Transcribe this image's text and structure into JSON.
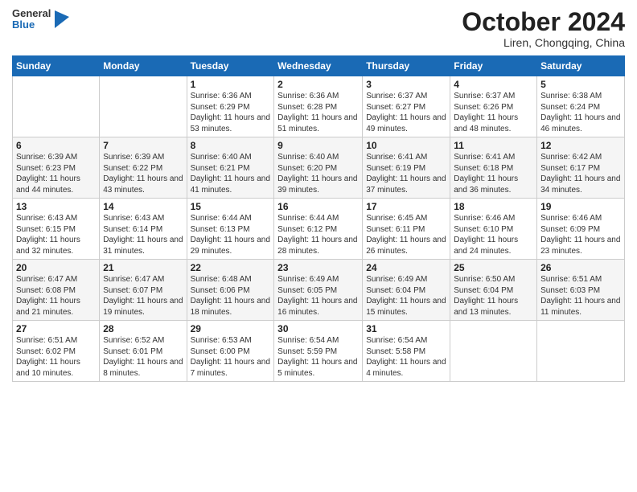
{
  "logo": {
    "line1": "General",
    "line2": "Blue"
  },
  "title": "October 2024",
  "location": "Liren, Chongqing, China",
  "days_of_week": [
    "Sunday",
    "Monday",
    "Tuesday",
    "Wednesday",
    "Thursday",
    "Friday",
    "Saturday"
  ],
  "weeks": [
    [
      {
        "day": "",
        "info": ""
      },
      {
        "day": "",
        "info": ""
      },
      {
        "day": "1",
        "info": "Sunrise: 6:36 AM\nSunset: 6:29 PM\nDaylight: 11 hours and 53 minutes."
      },
      {
        "day": "2",
        "info": "Sunrise: 6:36 AM\nSunset: 6:28 PM\nDaylight: 11 hours and 51 minutes."
      },
      {
        "day": "3",
        "info": "Sunrise: 6:37 AM\nSunset: 6:27 PM\nDaylight: 11 hours and 49 minutes."
      },
      {
        "day": "4",
        "info": "Sunrise: 6:37 AM\nSunset: 6:26 PM\nDaylight: 11 hours and 48 minutes."
      },
      {
        "day": "5",
        "info": "Sunrise: 6:38 AM\nSunset: 6:24 PM\nDaylight: 11 hours and 46 minutes."
      }
    ],
    [
      {
        "day": "6",
        "info": "Sunrise: 6:39 AM\nSunset: 6:23 PM\nDaylight: 11 hours and 44 minutes."
      },
      {
        "day": "7",
        "info": "Sunrise: 6:39 AM\nSunset: 6:22 PM\nDaylight: 11 hours and 43 minutes."
      },
      {
        "day": "8",
        "info": "Sunrise: 6:40 AM\nSunset: 6:21 PM\nDaylight: 11 hours and 41 minutes."
      },
      {
        "day": "9",
        "info": "Sunrise: 6:40 AM\nSunset: 6:20 PM\nDaylight: 11 hours and 39 minutes."
      },
      {
        "day": "10",
        "info": "Sunrise: 6:41 AM\nSunset: 6:19 PM\nDaylight: 11 hours and 37 minutes."
      },
      {
        "day": "11",
        "info": "Sunrise: 6:41 AM\nSunset: 6:18 PM\nDaylight: 11 hours and 36 minutes."
      },
      {
        "day": "12",
        "info": "Sunrise: 6:42 AM\nSunset: 6:17 PM\nDaylight: 11 hours and 34 minutes."
      }
    ],
    [
      {
        "day": "13",
        "info": "Sunrise: 6:43 AM\nSunset: 6:15 PM\nDaylight: 11 hours and 32 minutes."
      },
      {
        "day": "14",
        "info": "Sunrise: 6:43 AM\nSunset: 6:14 PM\nDaylight: 11 hours and 31 minutes."
      },
      {
        "day": "15",
        "info": "Sunrise: 6:44 AM\nSunset: 6:13 PM\nDaylight: 11 hours and 29 minutes."
      },
      {
        "day": "16",
        "info": "Sunrise: 6:44 AM\nSunset: 6:12 PM\nDaylight: 11 hours and 28 minutes."
      },
      {
        "day": "17",
        "info": "Sunrise: 6:45 AM\nSunset: 6:11 PM\nDaylight: 11 hours and 26 minutes."
      },
      {
        "day": "18",
        "info": "Sunrise: 6:46 AM\nSunset: 6:10 PM\nDaylight: 11 hours and 24 minutes."
      },
      {
        "day": "19",
        "info": "Sunrise: 6:46 AM\nSunset: 6:09 PM\nDaylight: 11 hours and 23 minutes."
      }
    ],
    [
      {
        "day": "20",
        "info": "Sunrise: 6:47 AM\nSunset: 6:08 PM\nDaylight: 11 hours and 21 minutes."
      },
      {
        "day": "21",
        "info": "Sunrise: 6:47 AM\nSunset: 6:07 PM\nDaylight: 11 hours and 19 minutes."
      },
      {
        "day": "22",
        "info": "Sunrise: 6:48 AM\nSunset: 6:06 PM\nDaylight: 11 hours and 18 minutes."
      },
      {
        "day": "23",
        "info": "Sunrise: 6:49 AM\nSunset: 6:05 PM\nDaylight: 11 hours and 16 minutes."
      },
      {
        "day": "24",
        "info": "Sunrise: 6:49 AM\nSunset: 6:04 PM\nDaylight: 11 hours and 15 minutes."
      },
      {
        "day": "25",
        "info": "Sunrise: 6:50 AM\nSunset: 6:04 PM\nDaylight: 11 hours and 13 minutes."
      },
      {
        "day": "26",
        "info": "Sunrise: 6:51 AM\nSunset: 6:03 PM\nDaylight: 11 hours and 11 minutes."
      }
    ],
    [
      {
        "day": "27",
        "info": "Sunrise: 6:51 AM\nSunset: 6:02 PM\nDaylight: 11 hours and 10 minutes."
      },
      {
        "day": "28",
        "info": "Sunrise: 6:52 AM\nSunset: 6:01 PM\nDaylight: 11 hours and 8 minutes."
      },
      {
        "day": "29",
        "info": "Sunrise: 6:53 AM\nSunset: 6:00 PM\nDaylight: 11 hours and 7 minutes."
      },
      {
        "day": "30",
        "info": "Sunrise: 6:54 AM\nSunset: 5:59 PM\nDaylight: 11 hours and 5 minutes."
      },
      {
        "day": "31",
        "info": "Sunrise: 6:54 AM\nSunset: 5:58 PM\nDaylight: 11 hours and 4 minutes."
      },
      {
        "day": "",
        "info": ""
      },
      {
        "day": "",
        "info": ""
      }
    ]
  ]
}
